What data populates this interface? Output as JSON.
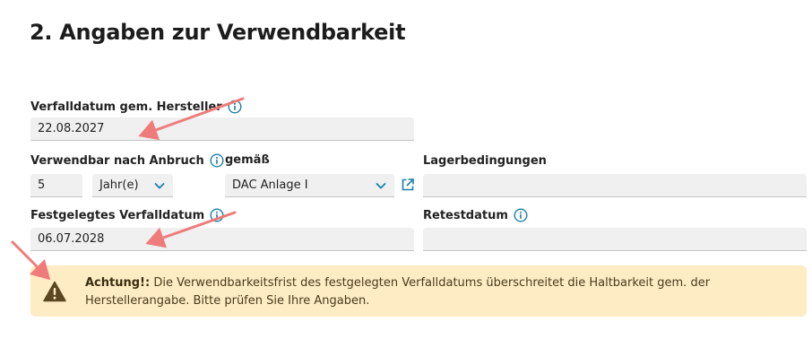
{
  "section": {
    "title": "2. Angaben zur Verwendbarkeit"
  },
  "fields": {
    "verfalldatum_hersteller": {
      "label": "Verfalldatum gem. Hersteller",
      "value": "22.08.2027"
    },
    "verwendbar_nach_anbruch": {
      "label": "Verwendbar nach Anbruch",
      "number_value": "5",
      "unit_value": "Jahr(e)"
    },
    "gemaess": {
      "label": "gemäß",
      "value": "DAC Anlage I"
    },
    "lagerbedingungen": {
      "label": "Lagerbedingungen",
      "value": ""
    },
    "festgelegtes_verfalldatum": {
      "label": "Festgelegtes Verfalldatum",
      "value": "06.07.2028"
    },
    "retestdatum": {
      "label": "Retestdatum",
      "value": ""
    }
  },
  "warning": {
    "prefix": "Achtung!:",
    "message": "Die Verwendbarkeitsfrist des festgelegten Verfalldatums überschreitet die Haltbarkeit gem. der Herstellerangabe. Bitte prüfen Sie Ihre Angaben."
  },
  "colors": {
    "accent": "#1a7fa6",
    "warning_bg": "#fdecc4",
    "annotation_arrow": "#ef7b7b",
    "field_bg": "#f0f0f0"
  },
  "icons": [
    "info-icon",
    "chevron-down-icon",
    "external-link-icon",
    "warning-icon",
    "annotation-arrow"
  ]
}
